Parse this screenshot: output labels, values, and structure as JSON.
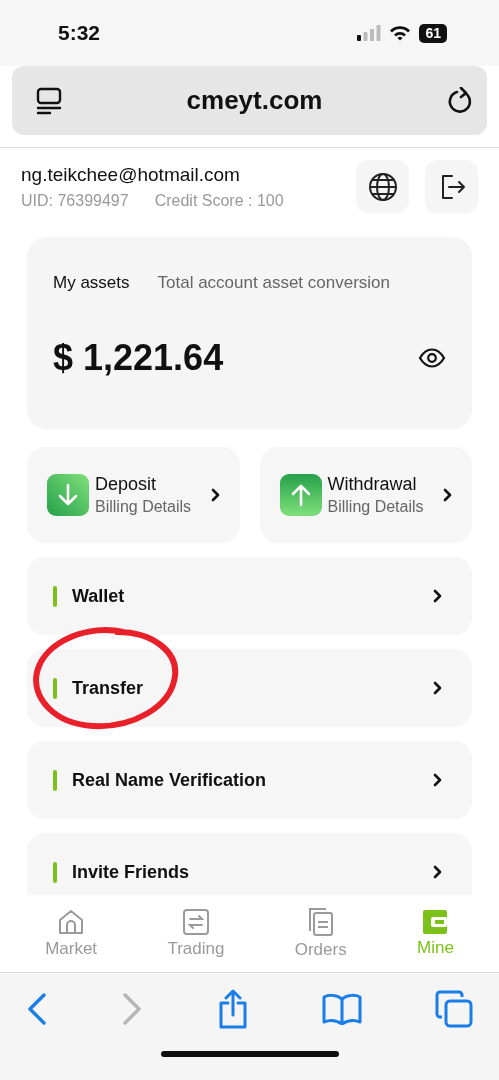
{
  "status_bar": {
    "time": "5:32",
    "battery": "61"
  },
  "browser": {
    "url": "cmeyt.com",
    "back_disabled": false,
    "forward_disabled": true
  },
  "account": {
    "email": "ng.teikchee@hotmail.com",
    "uid": "UID: 76399497",
    "credit_score": "Credit Score : 100"
  },
  "assets": {
    "title": "My assets",
    "subtitle": "Total account asset conversion",
    "amount": "$ 1,221.64"
  },
  "actions": [
    {
      "kind": "deposit",
      "title": "Deposit",
      "subtitle": "Billing Details"
    },
    {
      "kind": "withdrawal",
      "title": "Withdrawal",
      "subtitle": "Billing Details"
    }
  ],
  "menu": [
    {
      "label": "Wallet"
    },
    {
      "label": "Transfer"
    },
    {
      "label": "Real Name Verification"
    },
    {
      "label": "Invite Friends"
    }
  ],
  "tab_bar": [
    {
      "label": "Market",
      "selected": false
    },
    {
      "label": "Trading",
      "selected": false
    },
    {
      "label": "Orders",
      "selected": false
    },
    {
      "label": "Mine",
      "selected": true
    }
  ]
}
